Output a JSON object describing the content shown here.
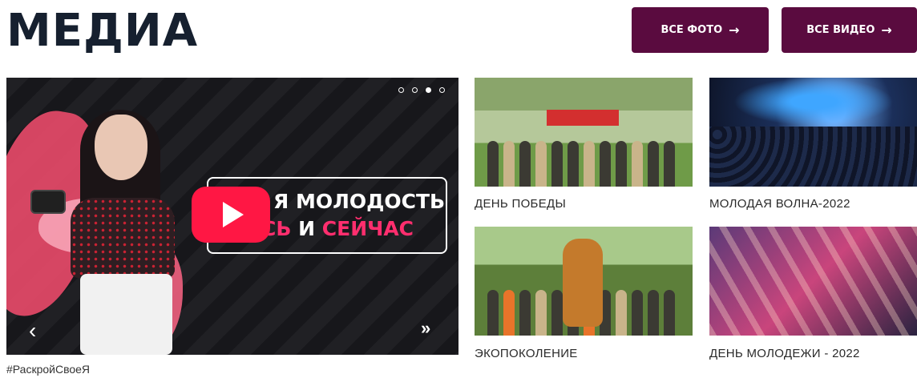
{
  "header": {
    "title": "МЕДИА",
    "buttons": {
      "photos_label": "ВСЕ ФОТО",
      "videos_label": "ВСЕ ВИДЕО",
      "arrow": "→"
    }
  },
  "hero": {
    "text_line1": "Я МОЛОДОСТЬ",
    "text_line2_part1": "СЬ",
    "text_line2_and": "И",
    "text_line2_part2": "СЕЙЧАС",
    "caption": "#РаскройСвоеЯ",
    "prev_arrow": "‹",
    "carousel_dots": 4,
    "active_dot": 3
  },
  "gallery": [
    {
      "caption": "ДЕНЬ ПОБЕДЫ"
    },
    {
      "caption": "МОЛОДАЯ ВОЛНА-2022"
    },
    {
      "caption": "ЭКОПОКОЛЕНИЕ"
    },
    {
      "caption": "ДЕНЬ МОЛОДЕЖИ - 2022"
    }
  ],
  "colors": {
    "button_bg": "#5a0b3f",
    "title": "#16202f",
    "accent_pink": "#ff2e6e",
    "play_red": "#ff1744"
  }
}
